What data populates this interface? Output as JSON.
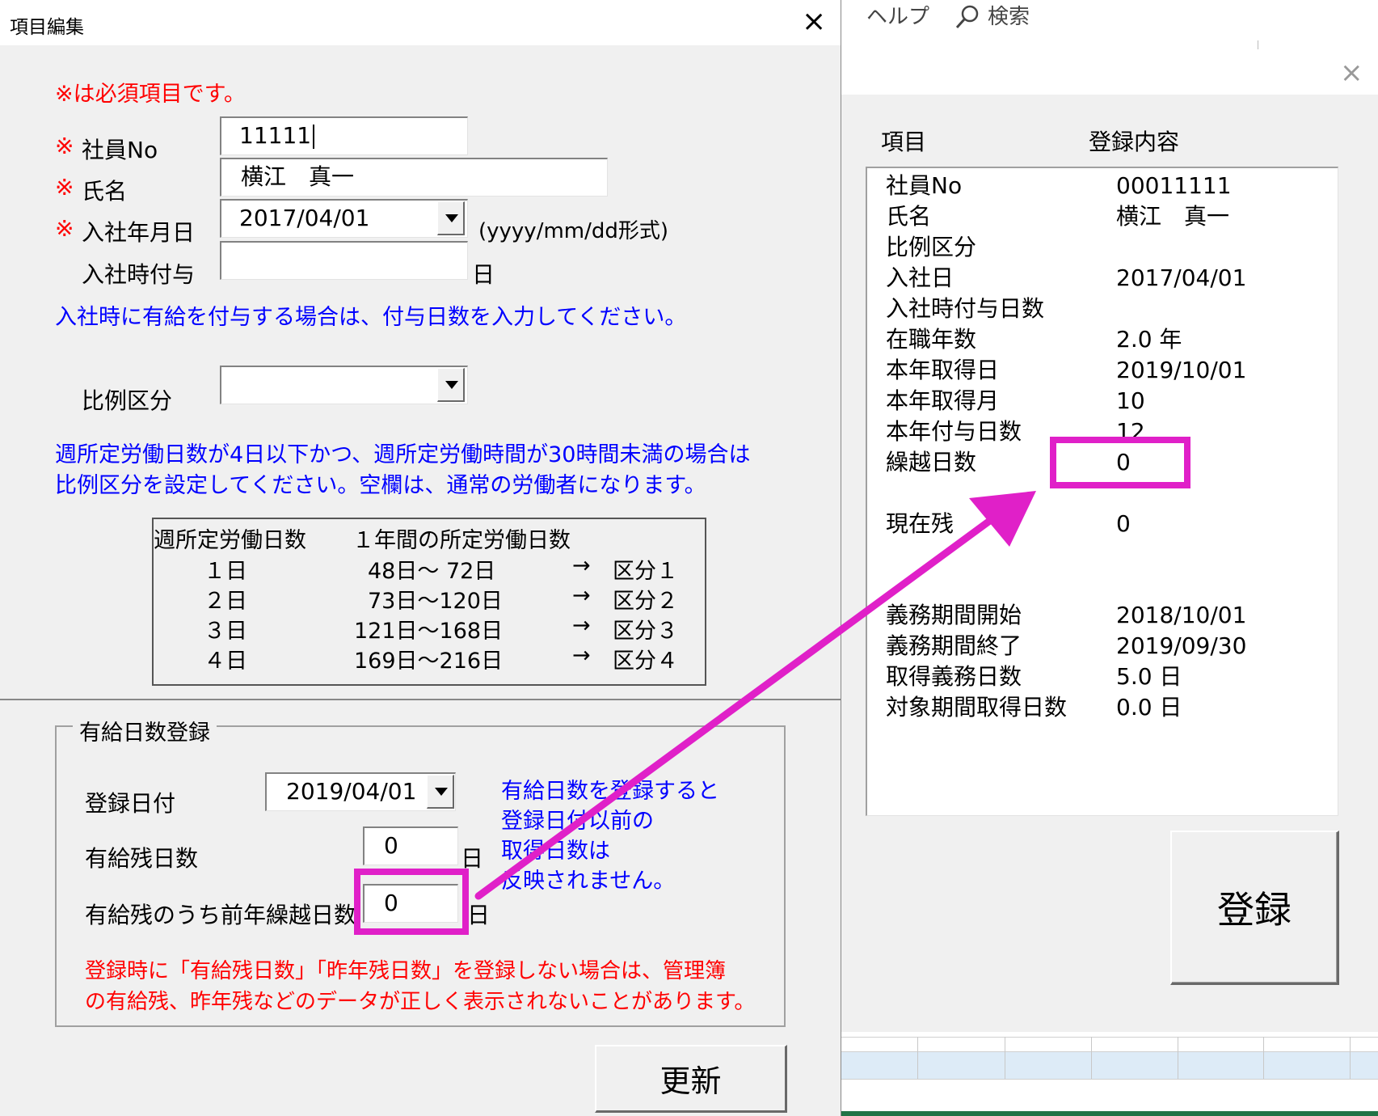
{
  "right_window": {
    "menu": {
      "help": "ヘルプ",
      "search": "検索"
    },
    "headers": {
      "item": "項目",
      "content": "登録内容"
    },
    "rows": [
      {
        "label": "社員No",
        "value": "00011111"
      },
      {
        "label": "氏名",
        "value": "横江　真一"
      },
      {
        "label": "比例区分",
        "value": ""
      },
      {
        "label": "入社日",
        "value": "2017/04/01"
      },
      {
        "label": "入社時付与日数",
        "value": ""
      },
      {
        "label": "在職年数",
        "value": "2.0 年"
      },
      {
        "label": "本年取得日",
        "value": "2019/10/01"
      },
      {
        "label": "本年取得月",
        "value": "10"
      },
      {
        "label": "本年付与日数",
        "value": "12"
      },
      {
        "label": "繰越日数",
        "value": "0"
      },
      {
        "label": "現在残",
        "value": "0"
      },
      {
        "label": "義務期間開始",
        "value": "2018/10/01"
      },
      {
        "label": "義務期間終了",
        "value": "2019/09/30"
      },
      {
        "label": "取得義務日数",
        "value": "5.0 日"
      },
      {
        "label": "対象期間取得日数",
        "value": "0.0 日"
      }
    ],
    "register_button": "登録",
    "close_glyph": "×"
  },
  "left_dialog": {
    "title": "項目編集",
    "close_glyph": "×",
    "required_note": "※は必須項目です。",
    "required_mark": "※",
    "fields": {
      "employee_no": {
        "label": "社員No",
        "value": "11111"
      },
      "name": {
        "label": "氏名",
        "value": "横江　真一"
      },
      "hire_date": {
        "label": "入社年月日",
        "value": "2017/04/01",
        "hint": "(yyyy/mm/dd形式)"
      },
      "hire_grant": {
        "label": "入社時付与",
        "value": "",
        "unit": "日"
      },
      "proportional": {
        "label": "比例区分",
        "value": ""
      }
    },
    "hire_grant_note": "入社時に有給を付与する場合は、付与日数を入力してください。",
    "proportional_note_1": "週所定労働日数が4日以下かつ、週所定労働時間が30時間未満の場合は",
    "proportional_note_2": "比例区分を設定してください。空欄は、通常の労働者になります。",
    "ref_table": {
      "header_1": "週所定労働日数",
      "header_2": "１年間の所定労働日数",
      "rows": [
        {
          "days": "１日",
          "range": "48日～  72日",
          "arrow": "→",
          "cls": "区分１"
        },
        {
          "days": "２日",
          "range": "73日～120日",
          "arrow": "→",
          "cls": "区分２"
        },
        {
          "days": "３日",
          "range": "121日～168日",
          "arrow": "→",
          "cls": "区分３"
        },
        {
          "days": "４日",
          "range": "169日～216日",
          "arrow": "→",
          "cls": "区分４"
        }
      ]
    },
    "paid_leave": {
      "frame_title": "有給日数登録",
      "reg_date": {
        "label": "登録日付",
        "value": "2019/04/01"
      },
      "remaining": {
        "label": "有給残日数",
        "value": "0",
        "unit": "日"
      },
      "carryover": {
        "label": "有給残のうち前年繰越日数",
        "value": "0",
        "unit": "日"
      },
      "info": [
        "有給日数を登録すると",
        "登録日付以前の",
        "取得日数は",
        "反映されません。"
      ],
      "warning_1": "登録時に「有給残日数」「昨年残日数」を登録しない場合は、管理簿",
      "warning_2": "の有給残、昨年残などのデータが正しく表示されないことがあります。"
    },
    "update_button": "更新"
  },
  "colors": {
    "annotation": "#e020c8",
    "required_red": "#ff0000",
    "note_blue": "#0000ff"
  }
}
